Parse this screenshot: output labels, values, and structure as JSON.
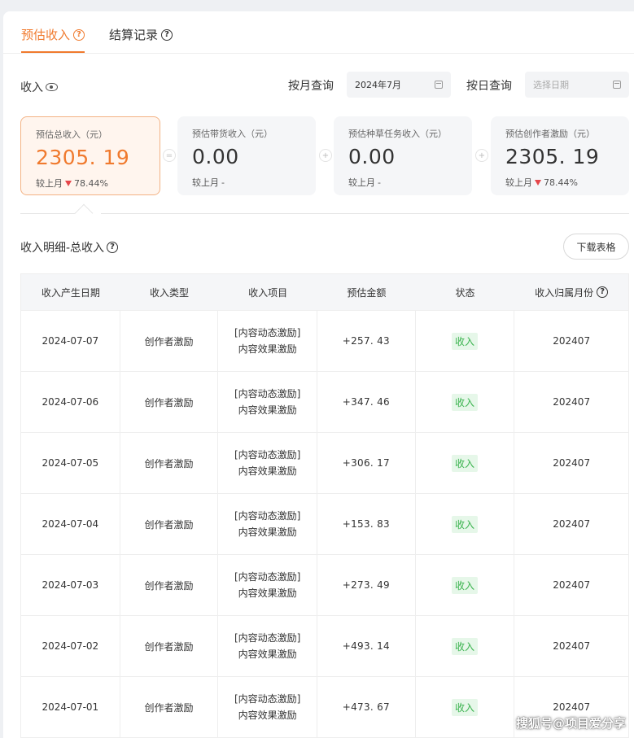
{
  "tabs": [
    {
      "label": "预估收入"
    },
    {
      "label": "结算记录"
    }
  ],
  "income": {
    "label": "收入",
    "month_query_label": "按月查询",
    "month_value": "2024年7月",
    "day_query_label": "按日查询",
    "day_placeholder": "选择日期"
  },
  "cards": [
    {
      "title": "预估总收入（元）",
      "value": "2305. 19",
      "compare_label": "较上月",
      "compare_value": "78.44%"
    },
    {
      "title": "预估带货收入（元）",
      "value": "0.00",
      "compare_label": "较上月",
      "compare_value": "-"
    },
    {
      "title": "预估种草任务收入（元）",
      "value": "0.00",
      "compare_label": "较上月",
      "compare_value": "-"
    },
    {
      "title": "预估创作者激励（元）",
      "value": "2305. 19",
      "compare_label": "较上月",
      "compare_value": "78.44%"
    }
  ],
  "operators": [
    "=",
    "+",
    "+"
  ],
  "detail": {
    "title": "收入明细-总收入",
    "download_label": "下载表格"
  },
  "table": {
    "headers": [
      "收入产生日期",
      "收入类型",
      "收入项目",
      "预估金额",
      "状态",
      "收入归属月份"
    ],
    "rows": [
      {
        "date": "2024-07-07",
        "type": "创作者激励",
        "proj1": "[内容动态激励]",
        "proj2": "内容效果激励",
        "amount": "+257. 43",
        "status": "收入",
        "month": "202407"
      },
      {
        "date": "2024-07-06",
        "type": "创作者激励",
        "proj1": "[内容动态激励]",
        "proj2": "内容效果激励",
        "amount": "+347. 46",
        "status": "收入",
        "month": "202407"
      },
      {
        "date": "2024-07-05",
        "type": "创作者激励",
        "proj1": "[内容动态激励]",
        "proj2": "内容效果激励",
        "amount": "+306. 17",
        "status": "收入",
        "month": "202407"
      },
      {
        "date": "2024-07-04",
        "type": "创作者激励",
        "proj1": "[内容动态激励]",
        "proj2": "内容效果激励",
        "amount": "+153. 83",
        "status": "收入",
        "month": "202407"
      },
      {
        "date": "2024-07-03",
        "type": "创作者激励",
        "proj1": "[内容动态激励]",
        "proj2": "内容效果激励",
        "amount": "+273. 49",
        "status": "收入",
        "month": "202407"
      },
      {
        "date": "2024-07-02",
        "type": "创作者激励",
        "proj1": "[内容动态激励]",
        "proj2": "内容效果激励",
        "amount": "+493. 14",
        "status": "收入",
        "month": "202407"
      },
      {
        "date": "2024-07-01",
        "type": "创作者激励",
        "proj1": "[内容动态激励]",
        "proj2": "内容效果激励",
        "amount": "+473. 67",
        "status": "收入",
        "month": "202407"
      }
    ]
  },
  "watermark": "搜狐号@项目爱分享",
  "colors": {
    "accent": "#f07a2e",
    "down": "#e5464a",
    "status_bg": "#e6f7e9",
    "status_text": "#3bb34f"
  }
}
